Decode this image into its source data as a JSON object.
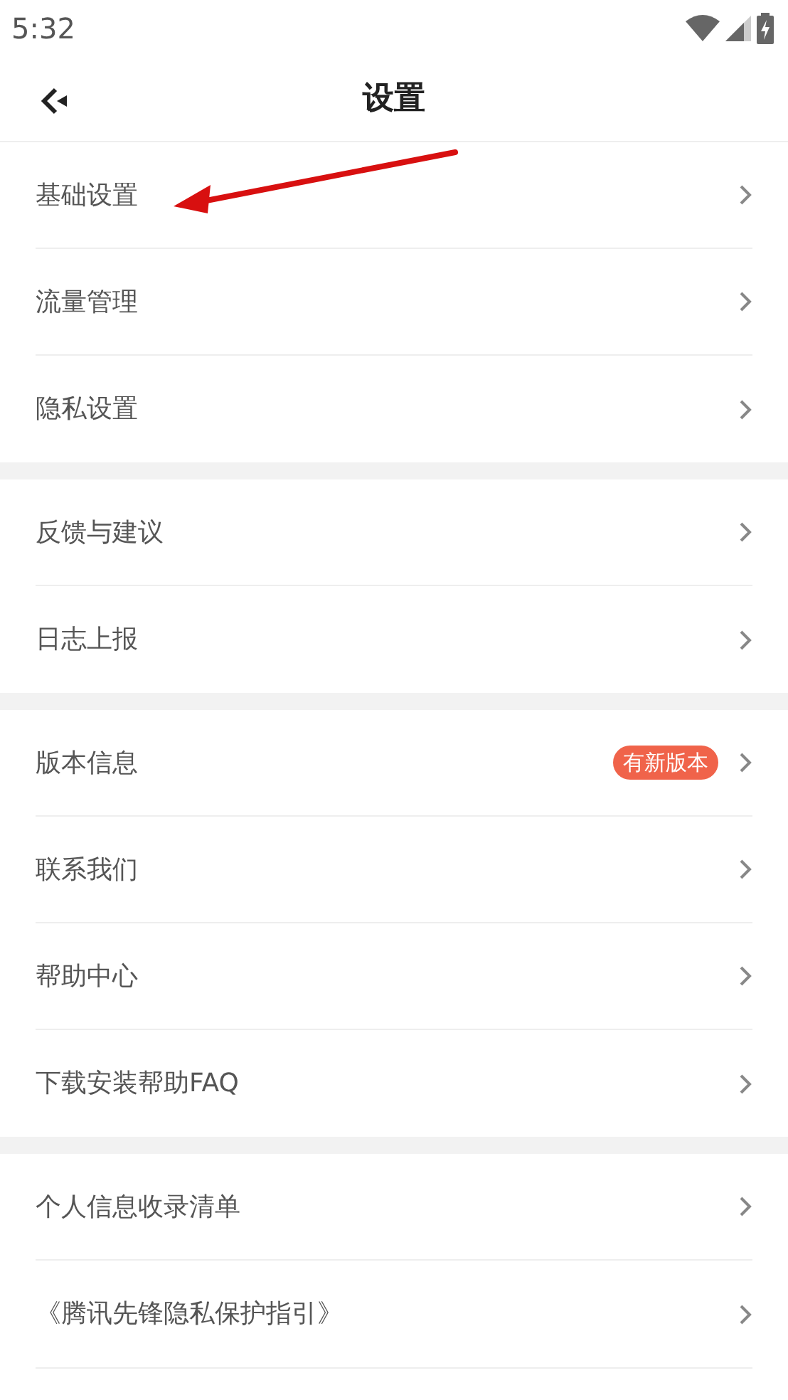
{
  "status_bar": {
    "time": "5:32"
  },
  "header": {
    "title": "设置"
  },
  "sections": [
    {
      "items": [
        {
          "label": "基础设置"
        },
        {
          "label": "流量管理"
        },
        {
          "label": "隐私设置"
        }
      ]
    },
    {
      "items": [
        {
          "label": "反馈与建议"
        },
        {
          "label": "日志上报"
        }
      ]
    },
    {
      "items": [
        {
          "label": "版本信息",
          "badge": "有新版本"
        },
        {
          "label": "联系我们"
        },
        {
          "label": "帮助中心"
        },
        {
          "label": "下载安装帮助FAQ"
        }
      ]
    },
    {
      "items": [
        {
          "label": "个人信息收录清单"
        },
        {
          "label": "《腾讯先锋隐私保护指引》"
        }
      ]
    }
  ]
}
